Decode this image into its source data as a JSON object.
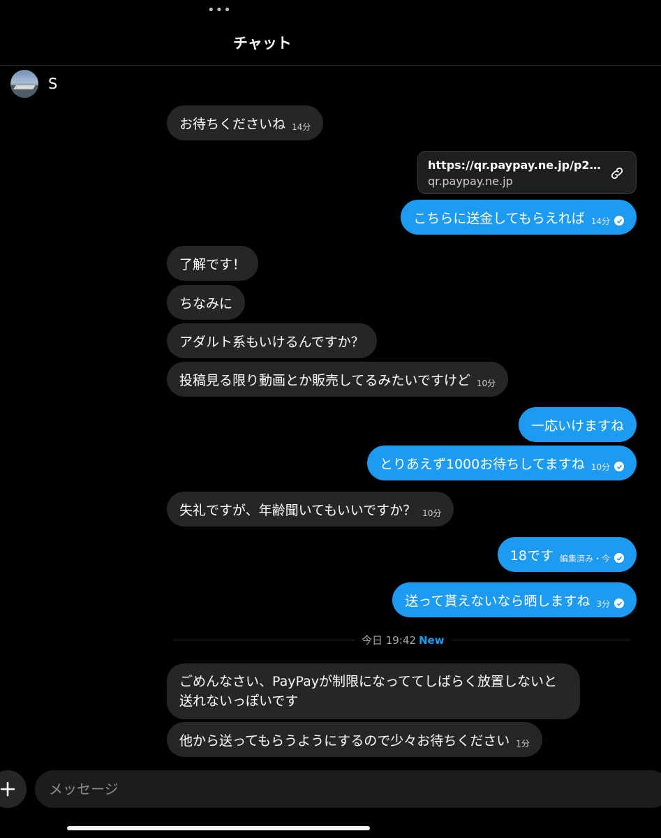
{
  "header": {
    "more": "•••",
    "title": "チャット"
  },
  "contact": {
    "name": "S"
  },
  "link_preview": {
    "url": "https://qr.paypay.ne.jp/p2p0…",
    "domain": "qr.paypay.ne.jp",
    "icon": "link-icon"
  },
  "messages": [
    {
      "side": "in",
      "text": "お待ちくださいね",
      "time": "14分"
    },
    {
      "side": "out",
      "text": "こちらに送金してもらえれば",
      "time": "14分",
      "read": true
    },
    {
      "side": "in",
      "text": "了解です！"
    },
    {
      "side": "in",
      "text": "ちなみに"
    },
    {
      "side": "in",
      "text": "アダルト系もいけるんですか？"
    },
    {
      "side": "in",
      "text": "投稿見る限り動画とか販売してるみたいですけど",
      "time": "10分"
    },
    {
      "side": "out",
      "text": "一応いけますね"
    },
    {
      "side": "out",
      "text": "とりあえず1000お待ちしてますね",
      "time": "10分",
      "read": true
    },
    {
      "side": "in",
      "text": "失礼ですが、年齢聞いてもいいですか？",
      "time": "10分"
    },
    {
      "side": "out",
      "text": "18です",
      "time": "編集済み・今",
      "read": true
    },
    {
      "side": "out",
      "text": "送って貰えないなら晒しますね",
      "time": "3分",
      "read": true
    },
    {
      "side": "in",
      "text": "ごめんなさい、PayPayが制限になっててしばらく放置しないと送れないっぽいです"
    },
    {
      "side": "in",
      "text": "他から送ってもらうようにするので少々お待ちください",
      "time": "1分"
    }
  ],
  "divider": {
    "label": "今日 19:42",
    "badge": "New"
  },
  "composer": {
    "placeholder": "メッセージ",
    "add_icon": "plus-icon"
  },
  "colors": {
    "background": "#000000",
    "incoming_bubble": "#262626",
    "outgoing_bubble": "#1d9bf0",
    "accent": "#1d9bf0"
  }
}
